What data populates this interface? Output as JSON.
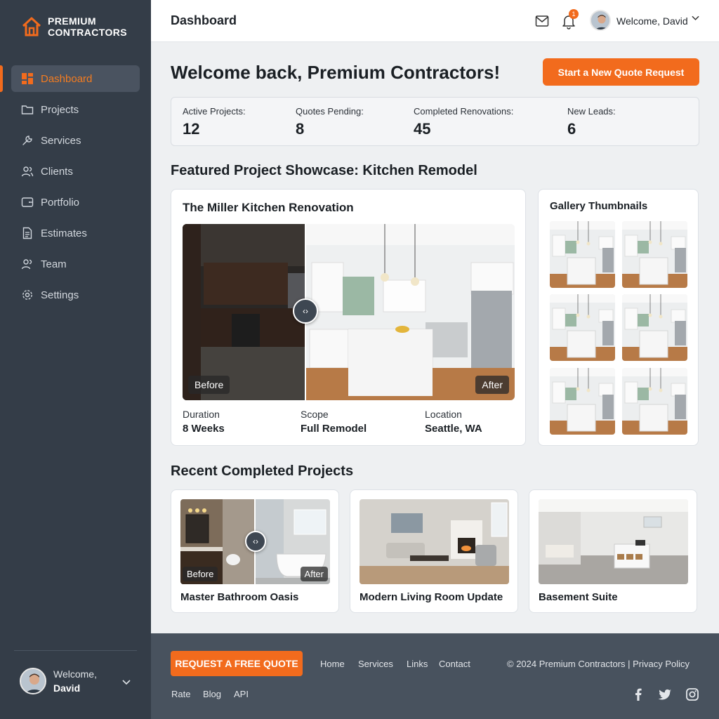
{
  "brand": {
    "line1": "PREMIUM",
    "line2": "CONTRACTORS",
    "accent": "#f26b1d"
  },
  "sidebar": {
    "items": [
      {
        "label": "Dashboard",
        "icon": "dashboard-icon",
        "active": true
      },
      {
        "label": "Projects",
        "icon": "folder-icon"
      },
      {
        "label": "Services",
        "icon": "wrench-icon"
      },
      {
        "label": "Clients",
        "icon": "users-icon"
      },
      {
        "label": "Portfolio",
        "icon": "portfolio-icon"
      },
      {
        "label": "Estimates",
        "icon": "document-icon"
      },
      {
        "label": "Team",
        "icon": "team-icon"
      },
      {
        "label": "Settings",
        "icon": "gear-icon"
      }
    ],
    "user": {
      "greeting": "Welcome,",
      "name": "David"
    }
  },
  "topbar": {
    "title": "Dashboard",
    "notification_count": "1",
    "welcome": "Welcome, David"
  },
  "main": {
    "heading": "Welcome back, Premium Contractors!",
    "cta_label": "Start a New Quote Request",
    "stats": [
      {
        "label": "Active Projects:",
        "value": "12"
      },
      {
        "label": "Quotes Pending:",
        "value": "8"
      },
      {
        "label": "Completed Renovations:",
        "value": "45"
      },
      {
        "label": "New Leads:",
        "value": "6"
      }
    ],
    "featured_heading": "Featured Project Showcase: Kitchen Remodel",
    "featured": {
      "title": "The Miller Kitchen Renovation",
      "before_label": "Before",
      "after_label": "After",
      "handle": "‹›",
      "meta": [
        {
          "label": "Duration",
          "value": "8 Weeks"
        },
        {
          "label": "Scope",
          "value": "Full Remodel"
        },
        {
          "label": "Location",
          "value": "Seattle, WA"
        }
      ]
    },
    "gallery_title": "Gallery Thumbnails",
    "recent_heading": "Recent Completed Projects",
    "recent": [
      {
        "name": "Master Bathroom Oasis",
        "before_label": "Before",
        "after_label": "After"
      },
      {
        "name": "Modern Living Room Update"
      },
      {
        "name": "Basement Suite"
      }
    ]
  },
  "footer": {
    "cta_label": "REQUEST A FREE QUOTE",
    "links_row1": [
      "Home",
      "Services",
      "Links",
      "Contact"
    ],
    "links_row2": [
      "Rate",
      "Blog",
      "API"
    ],
    "copyright": "© 2024 Premium Contractors | Privacy Policy"
  }
}
